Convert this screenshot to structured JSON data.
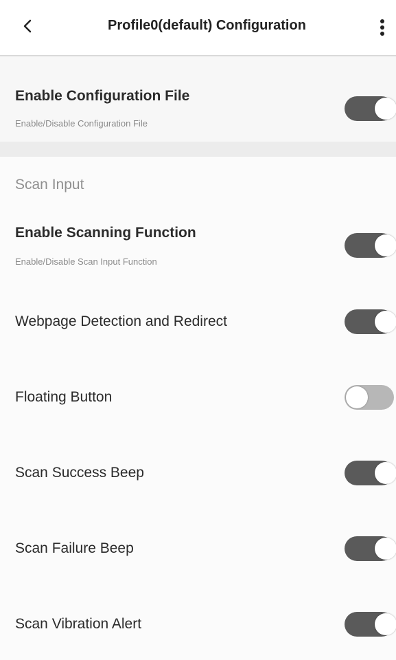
{
  "header": {
    "back_icon": "chevron-left-icon",
    "title": "Profile0(default) Configuration",
    "menu_icon": "more-vert-icon"
  },
  "colors": {
    "toggle_on": "#5a5a5a",
    "toggle_off": "#b7b7b7",
    "section_header": "#8f8f8f",
    "subtitle": "#8a8a8a"
  },
  "config_file": {
    "title": "Enable Configuration File",
    "subtitle": "Enable/Disable Configuration File",
    "enabled": true
  },
  "scan_input": {
    "header": "Scan Input",
    "items": [
      {
        "title": "Enable Scanning Function",
        "subtitle": "Enable/Disable Scan Input Function",
        "enabled": true
      },
      {
        "title": "Webpage Detection and Redirect",
        "enabled": true
      },
      {
        "title": "Floating Button",
        "enabled": false
      },
      {
        "title": "Scan Success Beep",
        "enabled": true
      },
      {
        "title": "Scan Failure Beep",
        "enabled": true
      },
      {
        "title": "Scan Vibration Alert",
        "enabled": true
      }
    ]
  }
}
